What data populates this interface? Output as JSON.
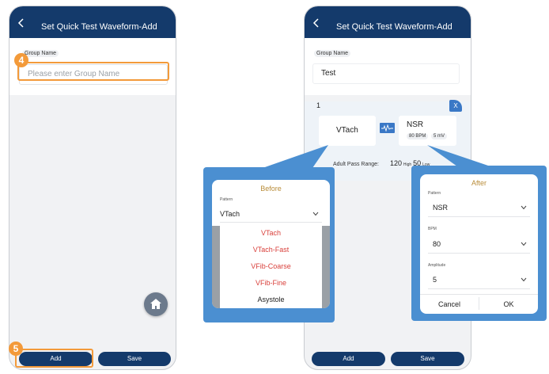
{
  "screen1": {
    "title": "Set Quick Test Waveform-Add",
    "group_label": "Group Name",
    "group_placeholder": "Please enter Group Name",
    "add_label": "Add",
    "save_label": "Save",
    "step_4": "4",
    "step_5": "5"
  },
  "screen2": {
    "title": "Set Quick Test Waveform-Add",
    "group_label": "Group Name",
    "group_value": "Test",
    "card_index": "1",
    "remove_label": "X",
    "before_waveform": "VTach",
    "after_waveform": "NSR",
    "after_bpm_chip": "80 BPM",
    "after_amp_chip": "5 mV",
    "range_label": "Adult Pass Range:",
    "range_high_value": "120",
    "range_high_label": "High",
    "range_low_value": "50",
    "range_low_label": "Low",
    "add_label": "Add",
    "save_label": "Save"
  },
  "before_popup": {
    "title": "Before",
    "pattern_label": "Pattern",
    "pattern_value": "VTach",
    "options": [
      "VTach",
      "VTach-Fast",
      "VFib-Coarse",
      "VFib-Fine",
      "Asystole"
    ]
  },
  "after_popup": {
    "title": "After",
    "pattern_label": "Pattern",
    "pattern_value": "NSR",
    "bpm_label": "BPM",
    "bpm_value": "80",
    "amplitude_label": "Amplitude",
    "amplitude_value": "5",
    "cancel_label": "Cancel",
    "ok_label": "OK"
  },
  "colors": {
    "titlebar": "#143a6b",
    "accent_blue": "#4b8fd1",
    "step_orange": "#f39a3a",
    "option_red": "#d9413c",
    "popup_title_gold": "#b98d3a"
  },
  "icons": [
    "back-icon",
    "home-icon",
    "chevron-down-icon",
    "waveform-convert-icon"
  ]
}
